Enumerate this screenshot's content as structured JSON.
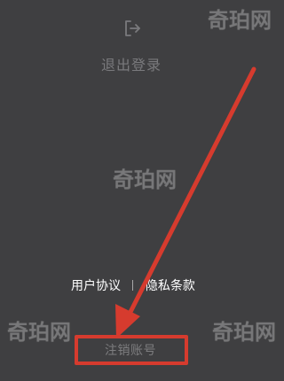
{
  "screen": {
    "logout_label": "退出登录",
    "user_agreement": "用户协议",
    "privacy_policy": "隐私条款",
    "delete_account": "注销账号",
    "watermarks": [
      "奇珀网",
      "奇珀网",
      "奇珀网",
      "奇珀网"
    ]
  },
  "colors": {
    "background": "#3f3f41",
    "annotation_red": "#d63b2e",
    "muted_text": "#7a7a7d",
    "white_text": "#ffffff"
  },
  "icons": {
    "logout": "logout-icon"
  }
}
